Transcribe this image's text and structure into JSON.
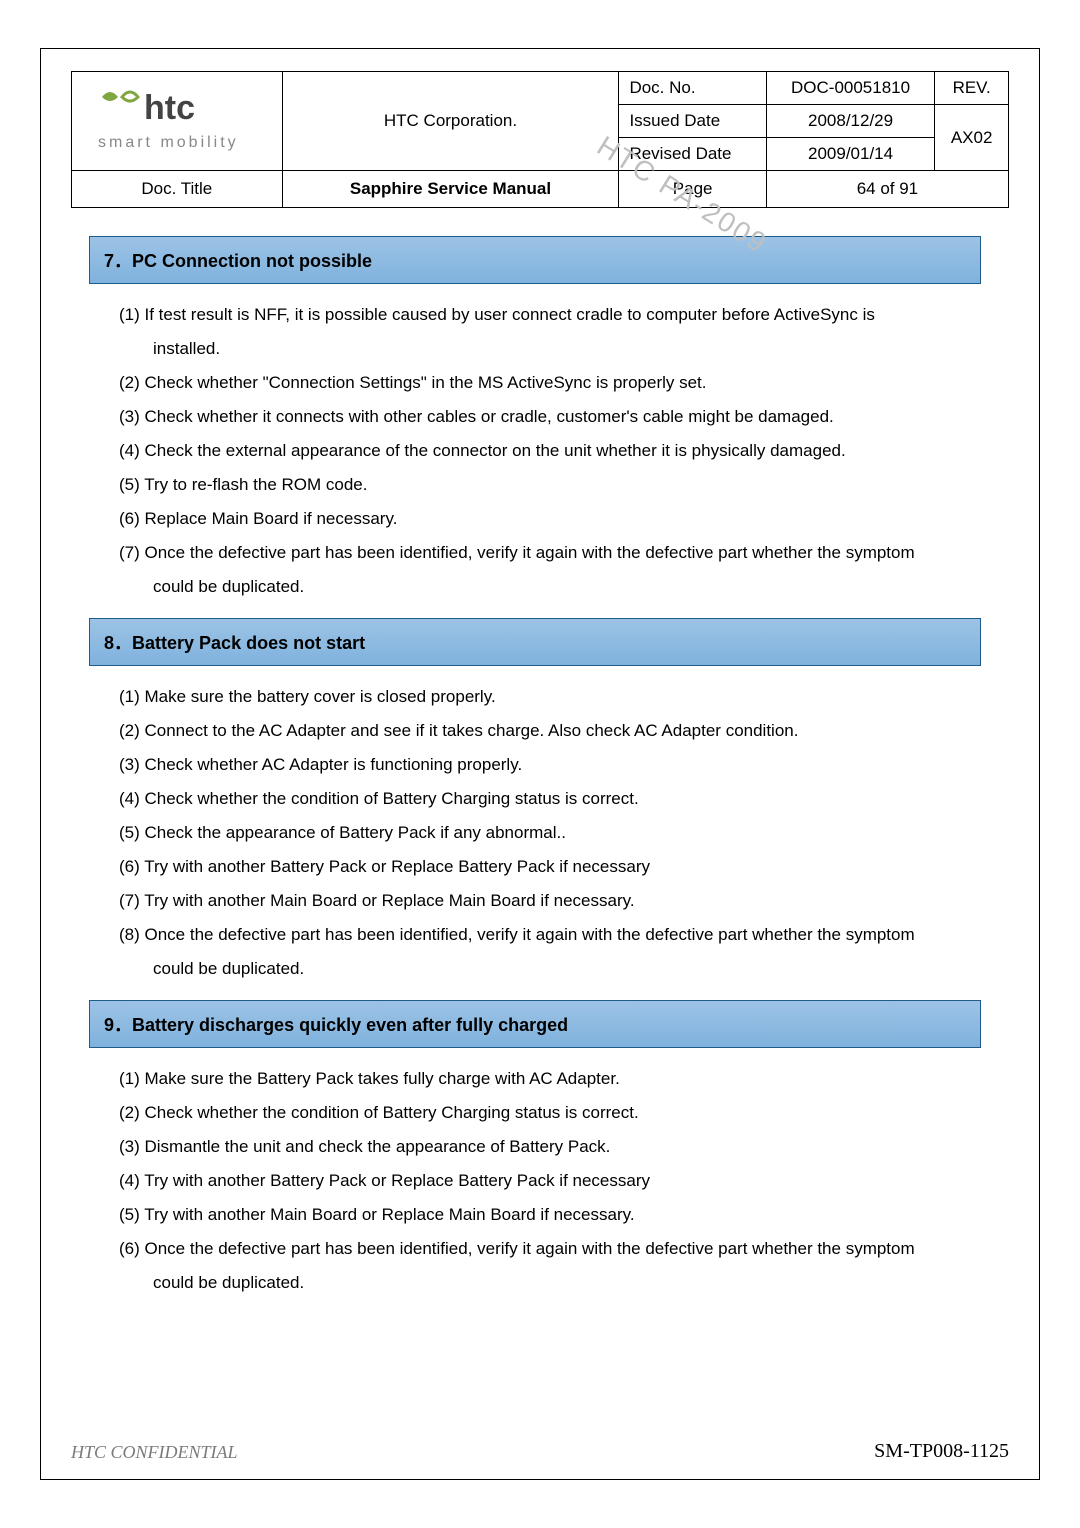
{
  "header": {
    "logo_brand": "htc",
    "logo_tag": "smart mobility",
    "corp": "HTC Corporation.",
    "doc_no_label": "Doc. No.",
    "doc_no_value": "DOC-00051810",
    "rev_label": "REV.",
    "rev_value": "AX02",
    "issued_label": "Issued Date",
    "issued_value": "2008/12/29",
    "revised_label": "Revised Date",
    "revised_value": "2009/01/14",
    "title_label": "Doc. Title",
    "title_value": "Sapphire Service Manual",
    "page_label": "Page",
    "page_value": "64  of  91"
  },
  "watermark": "HTC PA-2009",
  "sections": {
    "s7": {
      "head": "7．PC Connection not possible",
      "items": [
        "(1) If test result is NFF, it is possible caused by user connect cradle to computer before ActiveSync is",
        "installed.",
        "(2) Check whether \"Connection Settings\" in the MS ActiveSync is properly set.",
        "(3) Check whether it connects with other cables or cradle, customer's cable might be damaged.",
        "(4) Check the external appearance of the connector on the unit whether it is physically damaged.",
        "(5) Try to re-flash the ROM code.",
        "(6) Replace Main Board if necessary.",
        "(7) Once the defective part has been identified, verify it again with the defective part whether the symptom",
        "could be duplicated."
      ]
    },
    "s8": {
      "head": "8．Battery Pack does not start",
      "items": [
        "(1) Make sure the battery cover is closed properly.",
        "(2) Connect to the AC Adapter and see if it takes charge. Also check AC Adapter condition.",
        "(3) Check whether AC Adapter is functioning properly.",
        "(4) Check whether the condition of Battery Charging status is correct.",
        "(5) Check the appearance of Battery Pack if any abnormal..",
        "(6) Try with another Battery Pack or Replace Battery Pack if necessary",
        "(7) Try with another Main Board or Replace Main Board if necessary.",
        "(8) Once the defective part has been identified, verify it again with the defective part whether the symptom",
        "could be duplicated."
      ]
    },
    "s9": {
      "head": "9．Battery discharges quickly even after fully charged",
      "items": [
        "(1) Make sure the Battery Pack takes fully charge with AC Adapter.",
        "(2) Check whether the condition of Battery Charging status is correct.",
        "(3) Dismantle the unit and check the appearance of Battery Pack.",
        "(4) Try with another Battery Pack or Replace Battery Pack if necessary",
        "(5) Try with another Main Board or Replace Main Board if necessary.",
        "(6) Once the defective part has been identified, verify it again with the defective part whether the symptom",
        "could be duplicated."
      ]
    }
  },
  "footer": {
    "confidential": "HTC CONFIDENTIAL",
    "sm": "SM-TP008-1125"
  }
}
